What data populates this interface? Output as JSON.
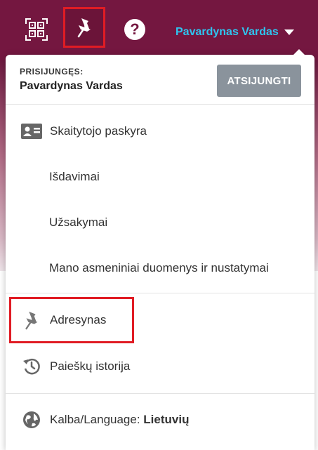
{
  "topbar": {
    "qr_icon": "qr-code-icon",
    "pin_icon": "pin-icon",
    "help_icon": "help-icon",
    "help_glyph": "?",
    "user_name": "Pavardynas Vardas",
    "caret_icon": "caret-down-icon"
  },
  "menu": {
    "signed_in_label": "PRISIJUNGĘS:",
    "signed_in_name": "Pavardynas Vardas",
    "logout_label": "ATSIJUNGTI",
    "account": {
      "label": "Skaitytojo paskyra",
      "icon": "id-card-icon"
    },
    "account_items": [
      {
        "label": "Išdavimai"
      },
      {
        "label": "Užsakymai"
      },
      {
        "label": "Mano asmeniniai duomenys ir nustatymai"
      }
    ],
    "bookmarks": {
      "label": "Adresynas",
      "icon": "pin-icon"
    },
    "history": {
      "label": "Paieškų istorija",
      "icon": "history-icon"
    },
    "language": {
      "label": "Kalba/Language: ",
      "value": "Lietuvių",
      "icon": "globe-icon"
    }
  },
  "colors": {
    "topbar_bg": "#741740",
    "user_link": "#2ec5f0",
    "logout_bg": "#8a939c",
    "highlight": "#e01c24"
  }
}
